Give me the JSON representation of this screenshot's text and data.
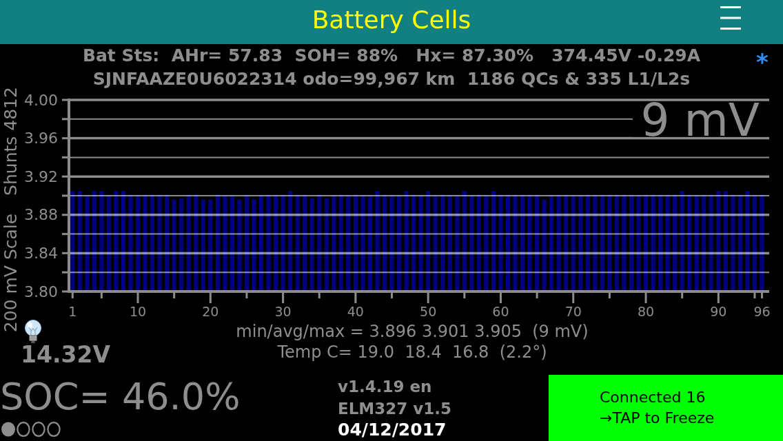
{
  "header": {
    "title": "Battery Cells"
  },
  "status_lines": [
    "Bat Sts:  AHr= 57.83  SOH= 88%   Hx= 87.30%   374.45V -0.29A",
    "SJNFAAZE0U6022314 odo=99,967 km  1186 QCs & 335 L1/L2s"
  ],
  "indicator": "*",
  "chart": {
    "shunts": "Shunts 4812",
    "spread": "9 mV",
    "chart_data": {
      "type": "bar",
      "ylabel": "200 mV Scale",
      "x": [
        1,
        2,
        3,
        4,
        5,
        6,
        7,
        8,
        9,
        10,
        11,
        12,
        13,
        14,
        15,
        16,
        17,
        18,
        19,
        20,
        21,
        22,
        23,
        24,
        25,
        26,
        27,
        28,
        29,
        30,
        31,
        32,
        33,
        34,
        35,
        36,
        37,
        38,
        39,
        40,
        41,
        42,
        43,
        44,
        45,
        46,
        47,
        48,
        49,
        50,
        51,
        52,
        53,
        54,
        55,
        56,
        57,
        58,
        59,
        60,
        61,
        62,
        63,
        64,
        65,
        66,
        67,
        68,
        69,
        70,
        71,
        72,
        73,
        74,
        75,
        76,
        77,
        78,
        79,
        80,
        81,
        82,
        83,
        84,
        85,
        86,
        87,
        88,
        89,
        90,
        91,
        92,
        93,
        94,
        95,
        96
      ],
      "values": [
        3.905,
        3.905,
        3.9,
        3.905,
        3.905,
        3.9,
        3.905,
        3.905,
        3.901,
        3.9,
        3.901,
        3.901,
        3.901,
        3.901,
        3.896,
        3.897,
        3.901,
        3.901,
        3.896,
        3.896,
        3.901,
        3.9,
        3.9,
        3.896,
        3.9,
        3.896,
        3.9,
        3.901,
        3.901,
        3.901,
        3.905,
        3.901,
        3.901,
        3.897,
        3.901,
        3.897,
        3.9,
        3.901,
        3.9,
        3.901,
        3.9,
        3.9,
        3.905,
        3.901,
        3.9,
        3.9,
        3.905,
        3.901,
        3.9,
        3.905,
        3.9,
        3.901,
        3.9,
        3.9,
        3.905,
        3.9,
        3.901,
        3.9,
        3.905,
        3.901,
        3.901,
        3.901,
        3.901,
        3.901,
        3.901,
        3.896,
        3.9,
        3.901,
        3.901,
        3.9,
        3.9,
        3.901,
        3.901,
        3.901,
        3.901,
        3.901,
        3.901,
        3.901,
        3.9,
        3.901,
        3.901,
        3.901,
        3.901,
        3.901,
        3.905,
        3.901,
        3.9,
        3.901,
        3.901,
        3.905,
        3.905,
        3.901,
        3.901,
        3.905,
        3.9,
        3.901
      ],
      "xlim": [
        0.5,
        97
      ],
      "ylim": [
        3.8,
        4.0
      ],
      "grid": true,
      "xticks": [
        1,
        10,
        20,
        30,
        40,
        50,
        60,
        70,
        80,
        90,
        96
      ],
      "yticks": [
        {
          "value": 3.8,
          "label": "3.80"
        },
        {
          "value": 3.84,
          "label": "3.84"
        },
        {
          "value": 3.88,
          "label": "3.88"
        },
        {
          "value": 3.92,
          "label": "3.92"
        },
        {
          "value": 3.96,
          "label": "3.96"
        },
        {
          "value": 4.0,
          "label": "4.00"
        }
      ]
    }
  },
  "aux_battery": {
    "voltage": "14.32V"
  },
  "summary": {
    "min_avg_max": "min/avg/max = 3.896 3.901 3.905  (9 mV)",
    "temperatures": "Temp C= 19.0  18.4  16.8  (2.2°)"
  },
  "soc": "SOC= 46.0%",
  "pages": [
    {
      "selected": true
    },
    {
      "selected": false
    },
    {
      "selected": false
    },
    {
      "selected": false
    }
  ],
  "versions": [
    "v1.4.19 en",
    "ELM327 v1.5"
  ],
  "date": "04/12/2017",
  "connection_button": {
    "lines": [
      "Connected 16",
      "→TAP to Freeze"
    ]
  }
}
